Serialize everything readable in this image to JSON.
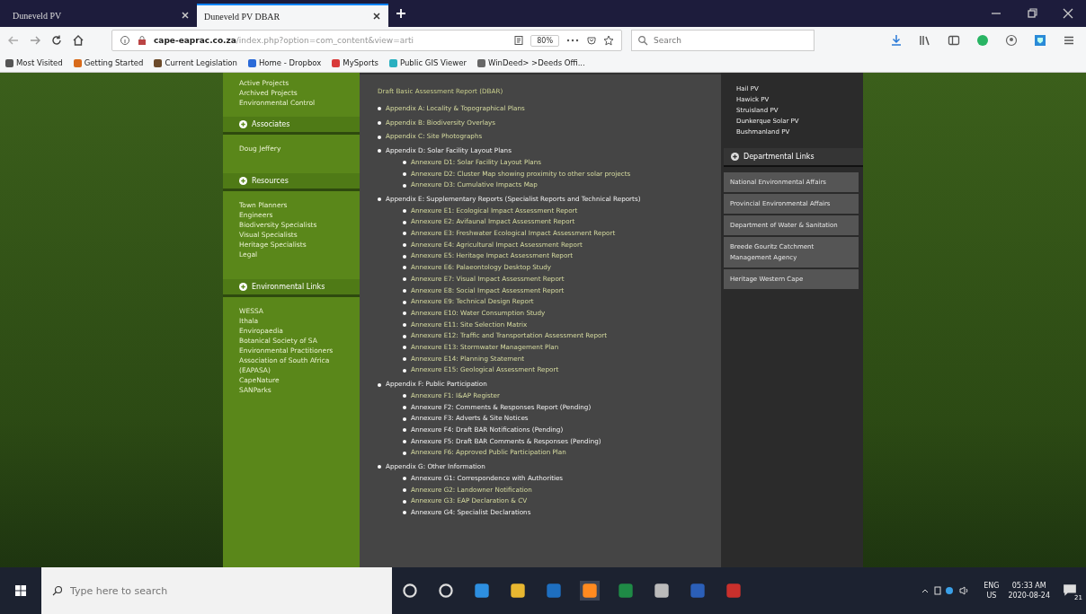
{
  "browser": {
    "tabs": [
      {
        "title": "Duneveld PV",
        "selected": false
      },
      {
        "title": "Duneveld PV DBAR",
        "selected": true
      }
    ],
    "address": {
      "domain": "cape-eaprac.co.za",
      "path": "/index.php?option=com_content&view=arti"
    },
    "zoom": "80%",
    "search": {
      "placeholder": "Search"
    },
    "bookmarks": [
      "Most Visited",
      "Getting Started",
      "Current Legislation",
      "Home - Dropbox",
      "MySports",
      "Public GIS Viewer",
      "WinDeed> >Deeds Offi..."
    ]
  },
  "sidebar": {
    "top_links": [
      "Active Projects",
      "Archived Projects",
      "Environmental Control"
    ],
    "sections": [
      {
        "title": "Associates",
        "links": [
          "Doug Jeffery"
        ]
      },
      {
        "title": "Resources",
        "links": [
          "Town Planners",
          "Engineers",
          "Biodiversity Specialists",
          "Visual Specialists",
          "Heritage Specialists",
          "Legal"
        ]
      },
      {
        "title": "Environmental Links",
        "links": [
          "WESSA",
          "Ithala",
          "Enviropaedia",
          "Botanical Society of SA",
          "Environmental Practitioners Association of South Africa (EAPASA)",
          "CapeNature",
          "SANParks"
        ]
      }
    ]
  },
  "content": {
    "heading": "Draft Basic Assessment Report (DBAR)",
    "items": [
      {
        "label": "Appendix A: Locality & Topographical Plans",
        "visited": false
      },
      {
        "label": "Appendix B: Biodiversity Overlays",
        "visited": false
      },
      {
        "label": "Appendix C: Site Photographs",
        "visited": false
      },
      {
        "label": "Appendix D: Solar Facility Layout Plans",
        "visited": true,
        "children": [
          {
            "label": "Annexure D1: Solar Facility Layout Plans",
            "visited": false
          },
          {
            "label": "Annexure D2: Cluster Map showing proximity to other solar projects",
            "visited": false
          },
          {
            "label": "Annexure D3: Cumulative Impacts Map",
            "visited": false
          }
        ]
      },
      {
        "label": "Appendix E: Supplementary Reports (Specialist Reports and Technical Reports)",
        "visited": true,
        "children": [
          {
            "label": "Annexure E1: Ecological Impact Assessment Report",
            "visited": false
          },
          {
            "label": "Annexure E2: Avifaunal Impact Assessment Report",
            "visited": false
          },
          {
            "label": "Annexure E3: Freshwater Ecological Impact Assessment Report",
            "visited": false
          },
          {
            "label": "Annexure E4: Agricultural Impact Assessment Report",
            "visited": false
          },
          {
            "label": "Annexure E5: Heritage Impact Assessment Report",
            "visited": false
          },
          {
            "label": "Annexure E6: Palaeontology Desktop Study",
            "visited": false
          },
          {
            "label": "Annexure E7: Visual Impact Assessment Report",
            "visited": false
          },
          {
            "label": "Annexure E8: Social Impact Assessment Report",
            "visited": false
          },
          {
            "label": "Annexure E9: Technical Design Report",
            "visited": false
          },
          {
            "label": "Annexure E10: Water Consumption Study",
            "visited": false
          },
          {
            "label": "Annexure E11: Site Selection Matrix",
            "visited": false
          },
          {
            "label": "Annexure E12: Traffic and Transportation Assessment Report",
            "visited": false
          },
          {
            "label": "Annexure E13: Stormwater Management Plan",
            "visited": false
          },
          {
            "label": "Annexure E14: Planning Statement",
            "visited": false
          },
          {
            "label": "Annexure E15: Geological Assessment Report",
            "visited": false
          }
        ]
      },
      {
        "label": "Appendix F: Public Participation",
        "visited": true,
        "children": [
          {
            "label": "Annexure F1: I&AP Register",
            "visited": false
          },
          {
            "label": "Annexure F2: Comments & Responses Report (Pending)",
            "visited": true
          },
          {
            "label": "Annexure F3: Adverts & Site Notices",
            "visited": true
          },
          {
            "label": "Annexure F4: Draft BAR Notifications (Pending)",
            "visited": true
          },
          {
            "label": "Annexure F5: Draft BAR Comments & Responses (Pending)",
            "visited": true
          },
          {
            "label": "Annexure F6: Approved Public Participation Plan",
            "visited": false
          }
        ]
      },
      {
        "label": "Appendix G: Other Information",
        "visited": true,
        "children": [
          {
            "label": "Annexure G1: Correspondence with Authorities",
            "visited": true
          },
          {
            "label": "Annexure G2: Landowner Notification",
            "visited": false
          },
          {
            "label": "Annexure G3: EAP Declaration & CV",
            "visited": false
          },
          {
            "label": "Annexure G4: Specialist Declarations",
            "visited": true
          }
        ]
      }
    ]
  },
  "right_panel": {
    "projects": [
      "Hail PV",
      "Hawick PV",
      "Struisland PV",
      "Dunkerque Solar PV",
      "Bushmanland PV"
    ],
    "section_title": "Departmental Links",
    "links": [
      "National Environmental Affairs",
      "Provincial Environmental Affairs",
      "Department of Water & Sanitation",
      "Breede Gouritz Catchment Management Agency",
      "Heritage Western Cape"
    ]
  },
  "taskbar": {
    "search": {
      "placeholder": "Type here to search"
    },
    "language": "ENG",
    "region": "US",
    "time": "05:33 AM",
    "date": "2020-08-24",
    "notifications": "21"
  }
}
